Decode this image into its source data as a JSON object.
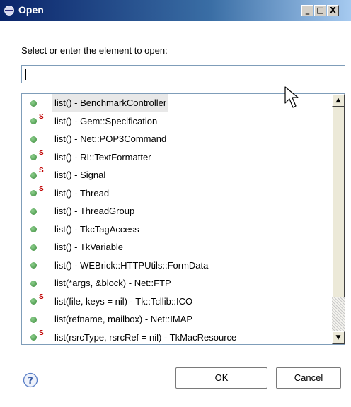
{
  "window": {
    "title": "Open",
    "minimize": "_",
    "maximize": "□",
    "close": "X"
  },
  "dialog": {
    "prompt": "Select or enter the element to open:",
    "search_value": "",
    "items": [
      {
        "label": "list() - BenchmarkController",
        "static": false,
        "selected": true
      },
      {
        "label": "list() - Gem::Specification",
        "static": true,
        "selected": false
      },
      {
        "label": "list() - Net::POP3Command",
        "static": false,
        "selected": false
      },
      {
        "label": "list() - RI::TextFormatter",
        "static": true,
        "selected": false
      },
      {
        "label": "list() - Signal",
        "static": true,
        "selected": false
      },
      {
        "label": "list() - Thread",
        "static": true,
        "selected": false
      },
      {
        "label": "list() - ThreadGroup",
        "static": false,
        "selected": false
      },
      {
        "label": "list() - TkcTagAccess",
        "static": false,
        "selected": false
      },
      {
        "label": "list() - TkVariable",
        "static": false,
        "selected": false
      },
      {
        "label": "list() - WEBrick::HTTPUtils::FormData",
        "static": false,
        "selected": false
      },
      {
        "label": "list(*args, &block) - Net::FTP",
        "static": false,
        "selected": false
      },
      {
        "label": "list(file, keys = nil) - Tk::Tcllib::ICO",
        "static": true,
        "selected": false
      },
      {
        "label": "list(refname, mailbox) - Net::IMAP",
        "static": false,
        "selected": false
      },
      {
        "label": "list(rsrcType, rsrcRef = nil) - TkMacResource",
        "static": true,
        "selected": false
      }
    ],
    "static_marker": "S",
    "ok_label": "OK",
    "cancel_label": "Cancel",
    "help_icon": "question-mark-icon"
  }
}
